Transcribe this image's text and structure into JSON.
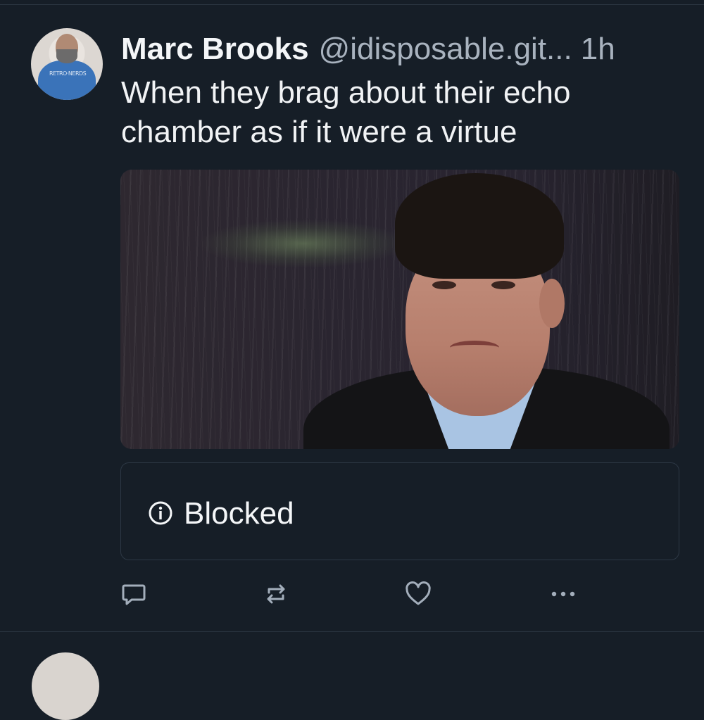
{
  "post": {
    "author_name": "Marc Brooks",
    "author_handle": "@idisposable.git...",
    "timestamp": "1h",
    "text": "When they brag about their echo\nchamber as if it were a virtue",
    "avatar_shirt_text": "RETRO·NERDS",
    "embed": {
      "status_label": "Blocked",
      "status_icon": "info-icon"
    },
    "actions": [
      "reply-icon",
      "repost-icon",
      "like-icon",
      "more-icon"
    ]
  },
  "colors": {
    "background": "#161e27",
    "text_primary": "#f1f3f5",
    "text_secondary": "#a9b3bf",
    "border": "#2d3845",
    "icon": "#a3aebb"
  }
}
